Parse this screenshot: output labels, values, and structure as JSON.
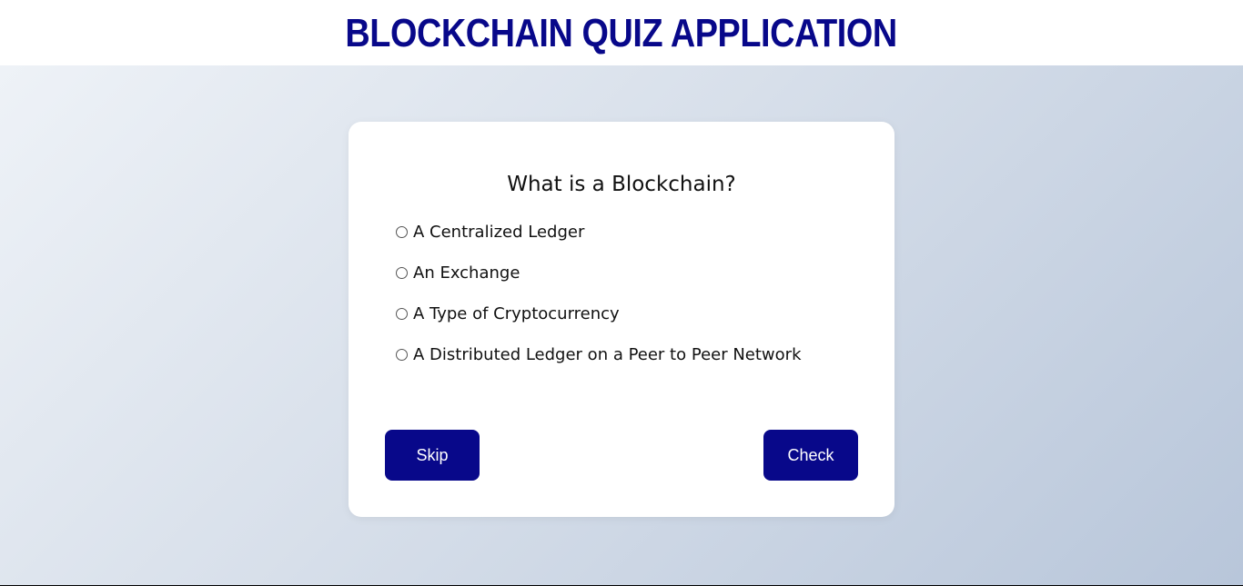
{
  "header": {
    "title": "BLOCKCHAIN QUIZ APPLICATION"
  },
  "quiz": {
    "question": "What is a Blockchain?",
    "options": [
      {
        "label": "A Centralized Ledger",
        "selected": false
      },
      {
        "label": "An Exchange",
        "selected": false
      },
      {
        "label": "A Type of Cryptocurrency",
        "selected": false
      },
      {
        "label": "A Distributed Ledger on a Peer to Peer Network",
        "selected": false
      }
    ],
    "buttons": {
      "skip_label": "Skip",
      "check_label": "Check"
    }
  },
  "colors": {
    "brand": "#08088a",
    "card": "#ffffff",
    "text": "#111111"
  }
}
